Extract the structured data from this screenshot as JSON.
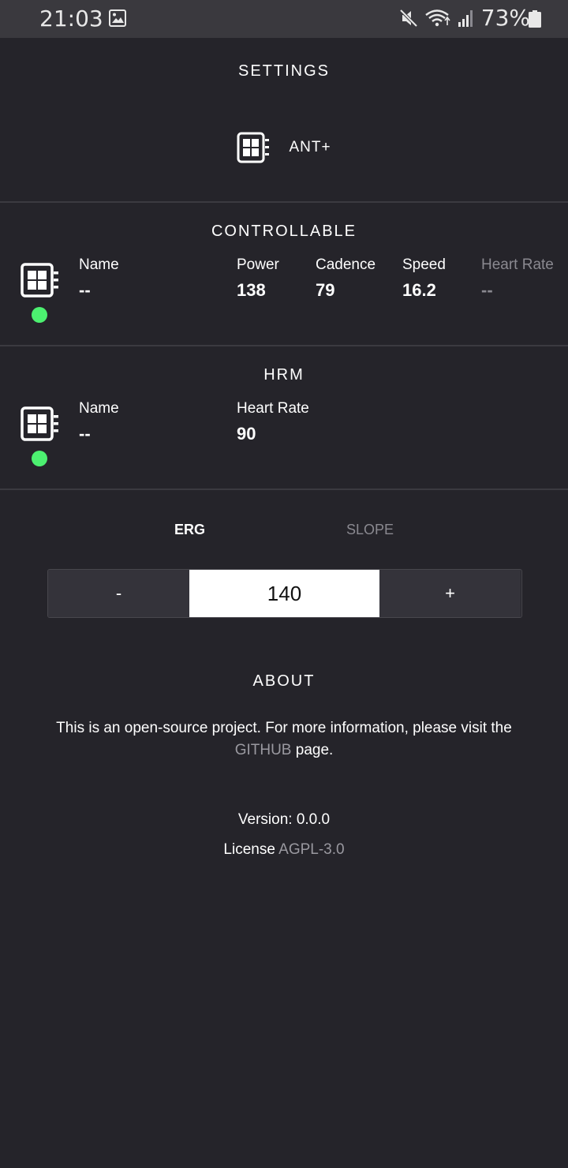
{
  "status_bar": {
    "time": "21:03",
    "battery": "73%",
    "icons": [
      "image-icon",
      "mute-icon",
      "wifi-icon",
      "signal-icon",
      "battery-icon"
    ]
  },
  "settings": {
    "title": "SETTINGS",
    "ant_label": "ANT+"
  },
  "controllable": {
    "title": "CONTROLLABLE",
    "status_color": "#4cf070",
    "name_label": "Name",
    "name_value": "--",
    "power_label": "Power",
    "power_value": "138",
    "cadence_label": "Cadence",
    "cadence_value": "79",
    "speed_label": "Speed",
    "speed_value": "16.2",
    "hr_label": "Heart Rate",
    "hr_value": "--"
  },
  "hrm": {
    "title": "HRM",
    "status_color": "#4cf070",
    "name_label": "Name",
    "name_value": "--",
    "hr_label": "Heart Rate",
    "hr_value": "90"
  },
  "mode": {
    "tabs": [
      "ERG",
      "SLOPE"
    ],
    "active_tab": "ERG",
    "minus_label": "-",
    "plus_label": "+",
    "value": "140"
  },
  "about": {
    "title": "ABOUT",
    "text_before": "This is an open-source project. For more information, please visit the",
    "link_text": "GITHUB",
    "text_after": "page.",
    "version_text": "Version: 0.0.0",
    "license_label": "License",
    "license_value": "AGPL-3.0"
  }
}
